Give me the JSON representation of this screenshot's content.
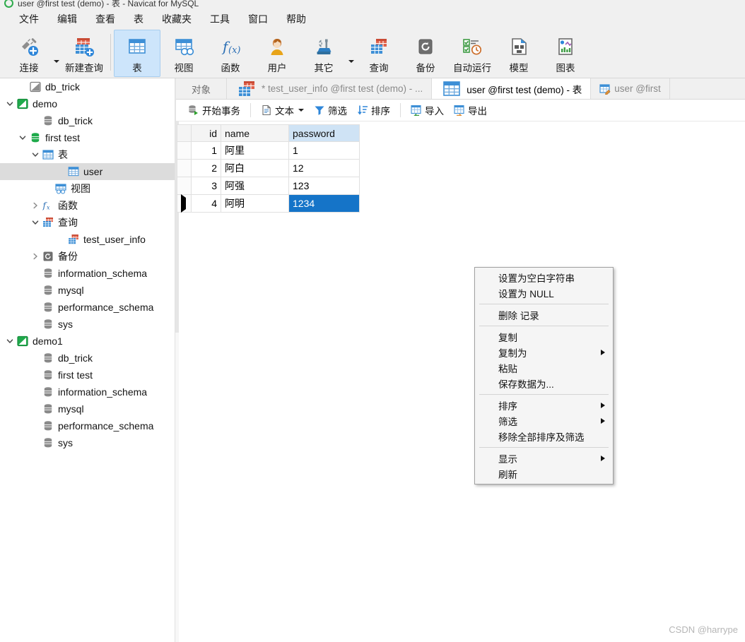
{
  "window": {
    "title": "user @first test (demo) - 表 - Navicat for MySQL",
    "logo": "navicat-logo-icon"
  },
  "menubar": {
    "items": [
      {
        "label": "文件",
        "name": "menu-file"
      },
      {
        "label": "编辑",
        "name": "menu-edit"
      },
      {
        "label": "查看",
        "name": "menu-view"
      },
      {
        "label": "表",
        "name": "menu-table"
      },
      {
        "label": "收藏夹",
        "name": "menu-favorites"
      },
      {
        "label": "工具",
        "name": "menu-tools"
      },
      {
        "label": "窗口",
        "name": "menu-window"
      },
      {
        "label": "帮助",
        "name": "menu-help"
      }
    ]
  },
  "toolbar": {
    "buttons": [
      {
        "label": "连接",
        "icon": "connection-icon",
        "active": false,
        "caret": true
      },
      {
        "label": "新建查询",
        "icon": "new-query-icon",
        "active": false,
        "caret": false
      },
      {
        "label": "表",
        "icon": "table-icon",
        "active": true,
        "caret": false
      },
      {
        "label": "视图",
        "icon": "view-icon",
        "active": false,
        "caret": false
      },
      {
        "label": "函数",
        "icon": "function-icon",
        "active": false,
        "caret": false
      },
      {
        "label": "用户",
        "icon": "user-icon",
        "active": false,
        "caret": false
      },
      {
        "label": "其它",
        "icon": "others-icon",
        "active": false,
        "caret": true
      },
      {
        "label": "查询",
        "icon": "query-icon",
        "active": false,
        "caret": false
      },
      {
        "label": "备份",
        "icon": "backup-icon",
        "active": false,
        "caret": false
      },
      {
        "label": "自动运行",
        "icon": "automation-icon",
        "active": false,
        "caret": false
      },
      {
        "label": "模型",
        "icon": "model-icon",
        "active": false,
        "caret": false
      },
      {
        "label": "图表",
        "icon": "chart-icon",
        "active": false,
        "caret": false
      }
    ]
  },
  "sidebar": {
    "nodes": [
      {
        "label": "db_trick",
        "icon": "connection-gray-icon",
        "indent": 1,
        "twisty": "none",
        "selected": false
      },
      {
        "label": "demo",
        "icon": "connection-green-icon",
        "indent": 0,
        "twisty": "expanded",
        "selected": false
      },
      {
        "label": "db_trick",
        "icon": "database-gray-icon",
        "indent": 2,
        "twisty": "none",
        "selected": false
      },
      {
        "label": "first test",
        "icon": "database-green-icon",
        "indent": 1,
        "twisty": "expanded",
        "selected": false
      },
      {
        "label": "表",
        "icon": "table-folder-icon",
        "indent": 2,
        "twisty": "expanded",
        "selected": false
      },
      {
        "label": "user",
        "icon": "table-icon",
        "indent": 4,
        "twisty": "none",
        "selected": true
      },
      {
        "label": "视图",
        "icon": "view-folder-icon",
        "indent": 3,
        "twisty": "none",
        "selected": false
      },
      {
        "label": "函数",
        "icon": "function-folder-icon",
        "indent": 2,
        "twisty": "collapsed",
        "selected": false
      },
      {
        "label": "查询",
        "icon": "query-folder-icon",
        "indent": 2,
        "twisty": "expanded",
        "selected": false
      },
      {
        "label": "test_user_info",
        "icon": "query-icon",
        "indent": 4,
        "twisty": "none",
        "selected": false
      },
      {
        "label": "备份",
        "icon": "backup-folder-icon",
        "indent": 2,
        "twisty": "collapsed",
        "selected": false
      },
      {
        "label": "information_schema",
        "icon": "database-gray-icon",
        "indent": 2,
        "twisty": "none",
        "selected": false
      },
      {
        "label": "mysql",
        "icon": "database-gray-icon",
        "indent": 2,
        "twisty": "none",
        "selected": false
      },
      {
        "label": "performance_schema",
        "icon": "database-gray-icon",
        "indent": 2,
        "twisty": "none",
        "selected": false
      },
      {
        "label": "sys",
        "icon": "database-gray-icon",
        "indent": 2,
        "twisty": "none",
        "selected": false
      },
      {
        "label": "demo1",
        "icon": "connection-green-icon",
        "indent": 0,
        "twisty": "expanded",
        "selected": false
      },
      {
        "label": "db_trick",
        "icon": "database-gray-icon",
        "indent": 2,
        "twisty": "none",
        "selected": false
      },
      {
        "label": "first test",
        "icon": "database-gray-icon",
        "indent": 2,
        "twisty": "none",
        "selected": false
      },
      {
        "label": "information_schema",
        "icon": "database-gray-icon",
        "indent": 2,
        "twisty": "none",
        "selected": false
      },
      {
        "label": "mysql",
        "icon": "database-gray-icon",
        "indent": 2,
        "twisty": "none",
        "selected": false
      },
      {
        "label": "performance_schema",
        "icon": "database-gray-icon",
        "indent": 2,
        "twisty": "none",
        "selected": false
      },
      {
        "label": "sys",
        "icon": "database-gray-icon",
        "indent": 2,
        "twisty": "none",
        "selected": false
      }
    ]
  },
  "tabs": [
    {
      "label": "对象",
      "icon": "none",
      "active": false,
      "kind": "objects"
    },
    {
      "label": "* test_user_info @first test (demo) - ...",
      "icon": "query-icon",
      "active": false,
      "kind": "query"
    },
    {
      "label": "user @first test (demo) - 表",
      "icon": "table-icon",
      "active": true,
      "kind": "table"
    },
    {
      "label": "user @first",
      "icon": "table-design-icon",
      "active": false,
      "kind": "design"
    }
  ],
  "gridbar": {
    "buttons": [
      {
        "label": "开始事务",
        "icon": "begin-transaction-icon",
        "caret": false
      },
      {
        "label": "文本",
        "icon": "text-icon",
        "caret": true
      },
      {
        "label": "筛选",
        "icon": "filter-icon",
        "caret": false
      },
      {
        "label": "排序",
        "icon": "sort-icon",
        "caret": false
      },
      {
        "label": "导入",
        "icon": "import-icon",
        "caret": false
      },
      {
        "label": "导出",
        "icon": "export-icon",
        "caret": false
      }
    ]
  },
  "grid": {
    "columns": [
      {
        "label": "id",
        "highlighted": false
      },
      {
        "label": "name",
        "highlighted": false
      },
      {
        "label": "password",
        "highlighted": true
      }
    ],
    "rows": [
      {
        "id": "1",
        "name": "阿里",
        "password": "1",
        "current": false,
        "selected_cell": ""
      },
      {
        "id": "2",
        "name": "阿白",
        "password": "12",
        "current": false,
        "selected_cell": ""
      },
      {
        "id": "3",
        "name": "阿强",
        "password": "123",
        "current": false,
        "selected_cell": ""
      },
      {
        "id": "4",
        "name": "阿明",
        "password": "1234",
        "current": true,
        "selected_cell": "password"
      }
    ]
  },
  "context_menu": {
    "groups": [
      [
        {
          "label": "设置为空白字符串",
          "submenu": false
        },
        {
          "label": "设置为 NULL",
          "submenu": false
        }
      ],
      [
        {
          "label": "删除 记录",
          "submenu": false
        }
      ],
      [
        {
          "label": "复制",
          "submenu": false
        },
        {
          "label": "复制为",
          "submenu": true
        },
        {
          "label": "粘贴",
          "submenu": false
        },
        {
          "label": "保存数据为...",
          "submenu": false
        }
      ],
      [
        {
          "label": "排序",
          "submenu": true
        },
        {
          "label": "筛选",
          "submenu": true
        },
        {
          "label": "移除全部排序及筛选",
          "submenu": false
        }
      ],
      [
        {
          "label": "显示",
          "submenu": true
        },
        {
          "label": "刷新",
          "submenu": false
        }
      ]
    ]
  },
  "watermark": {
    "text": "CSDN @harrype"
  },
  "colors": {
    "accent": "#1574c8",
    "toolbar_bg": "#f0f0f0",
    "active_tab_bg": "#ffffff",
    "selection_blue": "#1574c8",
    "header_highlight": "#cfe3f5",
    "tree_selected": "#dcdcdc",
    "navicat_green": "#2eab4c"
  }
}
